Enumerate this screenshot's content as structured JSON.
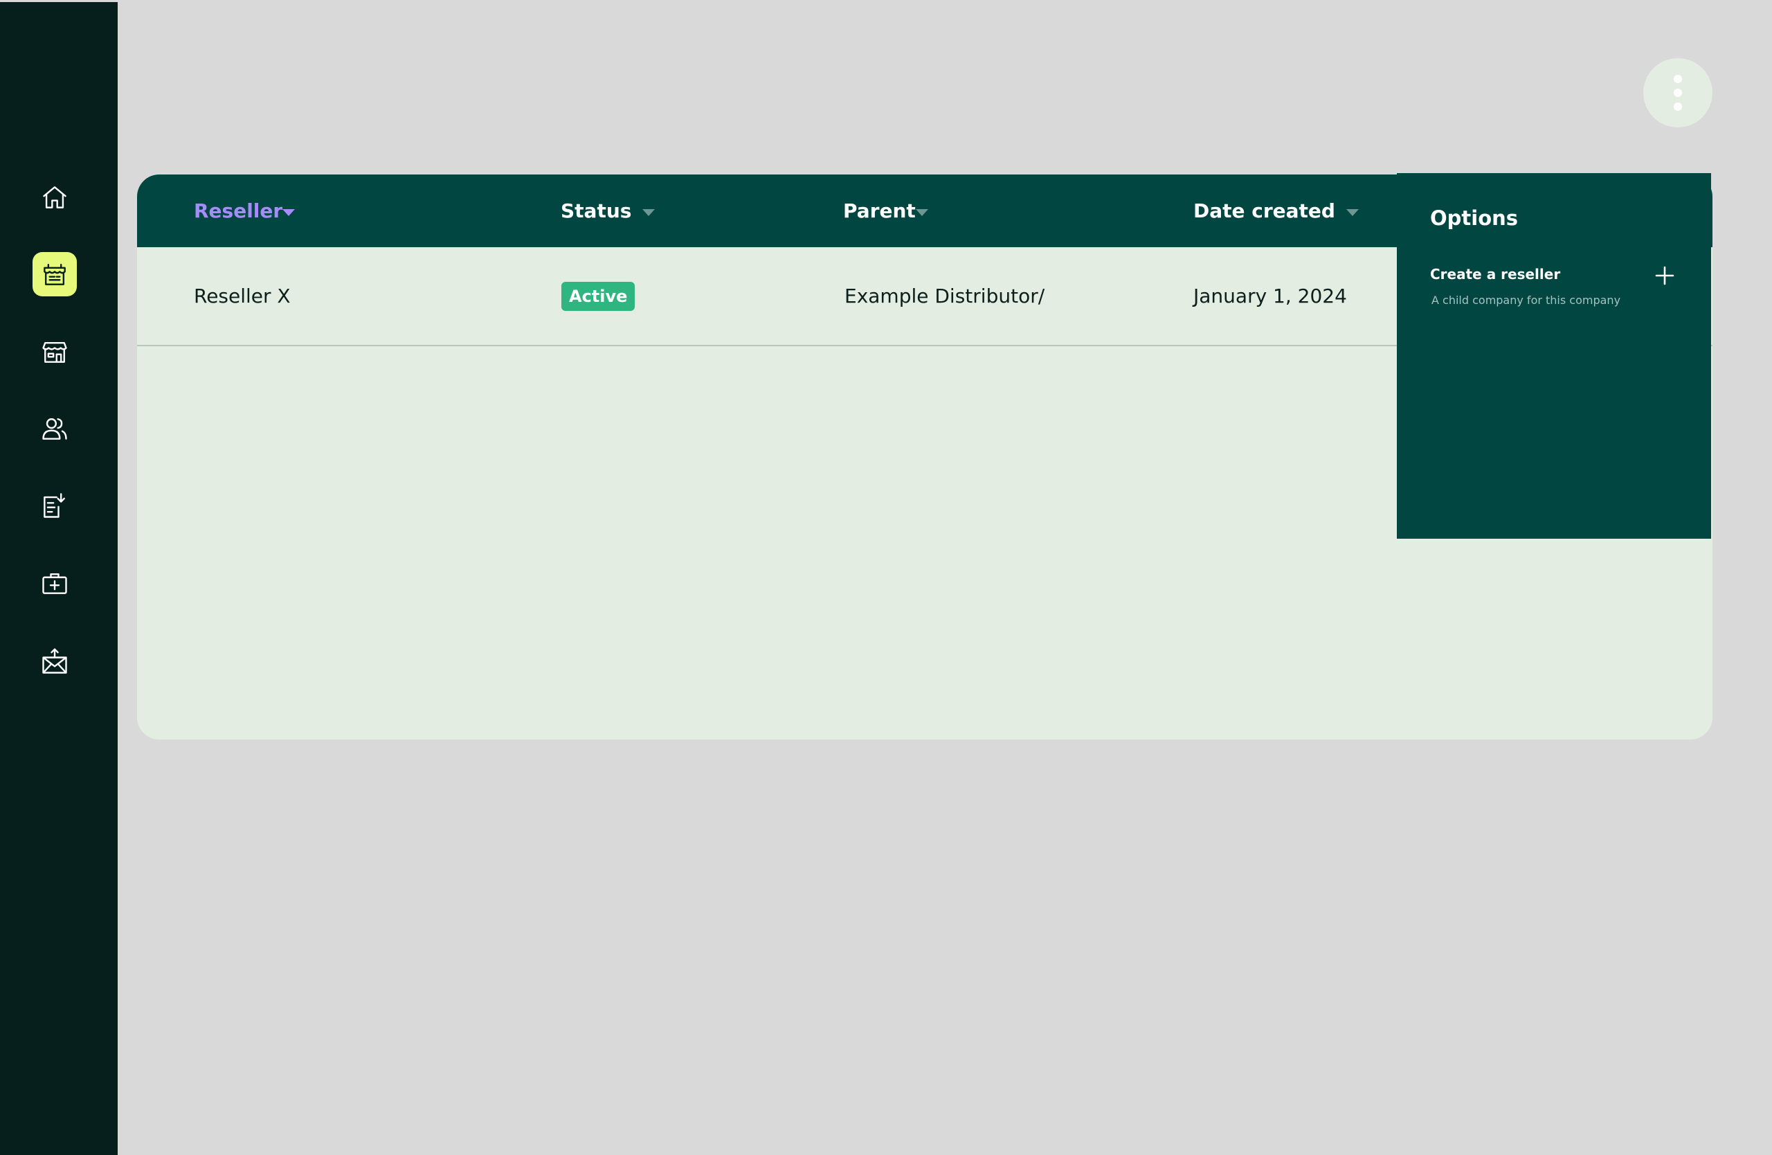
{
  "sidebar": {
    "items": [
      {
        "icon": "home-icon"
      },
      {
        "icon": "reseller-icon",
        "active": true
      },
      {
        "icon": "storefront-icon"
      },
      {
        "icon": "users-icon"
      },
      {
        "icon": "document-import-icon"
      },
      {
        "icon": "medical-kit-icon"
      },
      {
        "icon": "mail-upload-icon"
      }
    ],
    "accent_color": "#e6f97a",
    "background_color": "#061f1c"
  },
  "table": {
    "columns": [
      {
        "label": "Reseller",
        "sorted": true
      },
      {
        "label": "Status"
      },
      {
        "label": "Parent"
      },
      {
        "label": "Date created"
      }
    ],
    "rows": [
      {
        "reseller": "Reseller X",
        "status": "Active",
        "parent": "Example Distributor/",
        "date_created": "January 1, 2024"
      }
    ],
    "header_color": "#024641",
    "body_color": "#e3ede2",
    "sorted_color": "#a78bfa",
    "status_active_color": "#2fb57f"
  },
  "options_menu": {
    "title": "Options",
    "items": [
      {
        "label": "Create a reseller",
        "description": "A child company for this company",
        "icon": "plus-icon"
      }
    ]
  },
  "more_button": {
    "icon": "kebab-vertical-icon"
  }
}
